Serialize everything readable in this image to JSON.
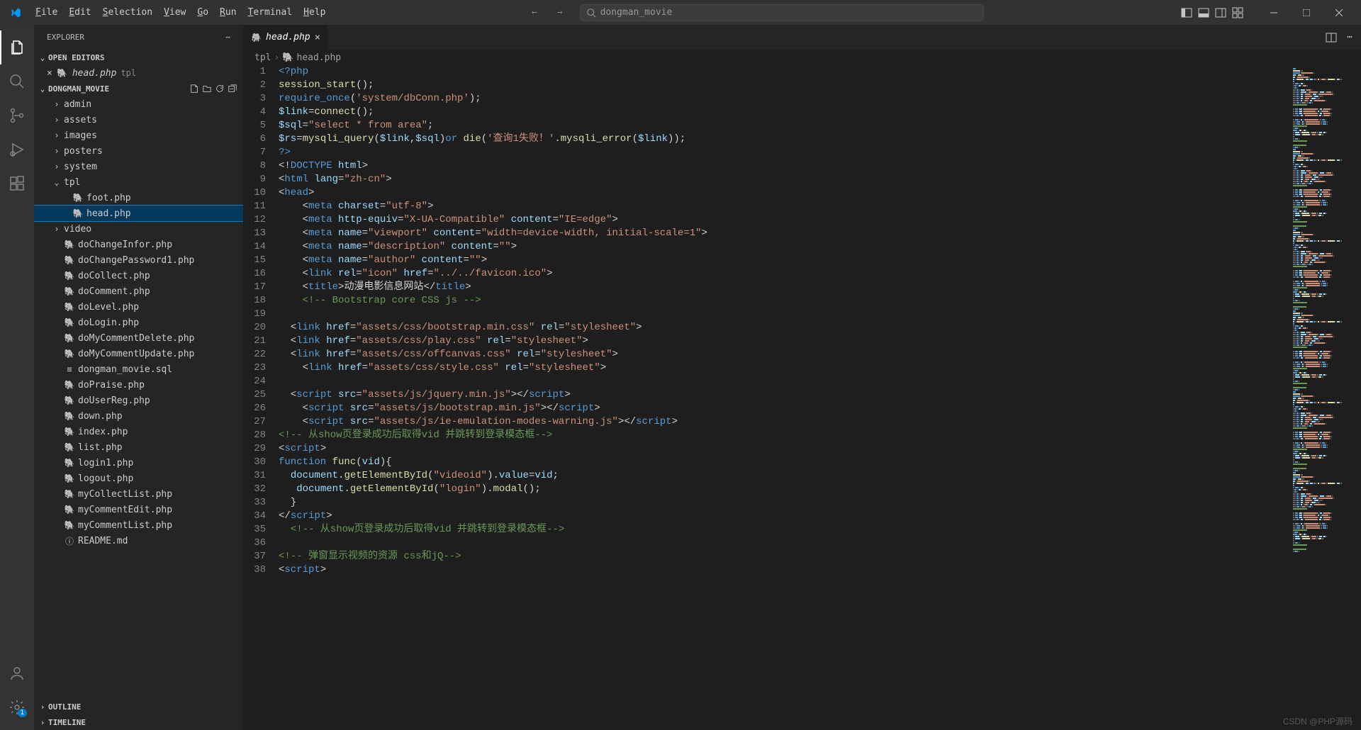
{
  "menu": [
    "File",
    "Edit",
    "Selection",
    "View",
    "Go",
    "Run",
    "Terminal",
    "Help"
  ],
  "search_text": "dongman_movie",
  "sidebar": {
    "title": "EXPLORER",
    "open_editors_label": "OPEN EDITORS",
    "open_file": "head.php",
    "open_file_folder": "tpl",
    "project": "DONGMAN_MOVIE",
    "outline": "OUTLINE",
    "timeline": "TIMELINE"
  },
  "tree": [
    {
      "type": "folder",
      "name": "admin",
      "depth": 0,
      "expanded": false
    },
    {
      "type": "folder",
      "name": "assets",
      "depth": 0,
      "expanded": false
    },
    {
      "type": "folder",
      "name": "images",
      "depth": 0,
      "expanded": false
    },
    {
      "type": "folder",
      "name": "posters",
      "depth": 0,
      "expanded": false
    },
    {
      "type": "folder",
      "name": "system",
      "depth": 0,
      "expanded": false
    },
    {
      "type": "folder",
      "name": "tpl",
      "depth": 0,
      "expanded": true
    },
    {
      "type": "file",
      "name": "foot.php",
      "depth": 1,
      "icon": "php"
    },
    {
      "type": "file",
      "name": "head.php",
      "depth": 1,
      "icon": "php",
      "active": true
    },
    {
      "type": "folder",
      "name": "video",
      "depth": 0,
      "expanded": false
    },
    {
      "type": "file",
      "name": "doChangeInfor.php",
      "depth": 0,
      "icon": "php"
    },
    {
      "type": "file",
      "name": "doChangePassword1.php",
      "depth": 0,
      "icon": "php"
    },
    {
      "type": "file",
      "name": "doCollect.php",
      "depth": 0,
      "icon": "php"
    },
    {
      "type": "file",
      "name": "doComment.php",
      "depth": 0,
      "icon": "php"
    },
    {
      "type": "file",
      "name": "doLevel.php",
      "depth": 0,
      "icon": "php"
    },
    {
      "type": "file",
      "name": "doLogin.php",
      "depth": 0,
      "icon": "php"
    },
    {
      "type": "file",
      "name": "doMyCommentDelete.php",
      "depth": 0,
      "icon": "php"
    },
    {
      "type": "file",
      "name": "doMyCommentUpdate.php",
      "depth": 0,
      "icon": "php"
    },
    {
      "type": "file",
      "name": "dongman_movie.sql",
      "depth": 0,
      "icon": "sql"
    },
    {
      "type": "file",
      "name": "doPraise.php",
      "depth": 0,
      "icon": "php"
    },
    {
      "type": "file",
      "name": "doUserReg.php",
      "depth": 0,
      "icon": "php"
    },
    {
      "type": "file",
      "name": "down.php",
      "depth": 0,
      "icon": "php"
    },
    {
      "type": "file",
      "name": "index.php",
      "depth": 0,
      "icon": "php"
    },
    {
      "type": "file",
      "name": "list.php",
      "depth": 0,
      "icon": "php"
    },
    {
      "type": "file",
      "name": "login1.php",
      "depth": 0,
      "icon": "php"
    },
    {
      "type": "file",
      "name": "logout.php",
      "depth": 0,
      "icon": "php"
    },
    {
      "type": "file",
      "name": "myCollectList.php",
      "depth": 0,
      "icon": "php"
    },
    {
      "type": "file",
      "name": "myCommentEdit.php",
      "depth": 0,
      "icon": "php"
    },
    {
      "type": "file",
      "name": "myCommentList.php",
      "depth": 0,
      "icon": "php"
    },
    {
      "type": "file",
      "name": "README.md",
      "depth": 0,
      "icon": "info"
    }
  ],
  "tab": {
    "name": "head.php"
  },
  "breadcrumbs": [
    "tpl",
    "head.php"
  ],
  "code": [
    {
      "n": 1,
      "tokens": [
        [
          "k",
          "<?php"
        ]
      ]
    },
    {
      "n": 2,
      "tokens": [
        [
          "f",
          "session_start"
        ],
        [
          "p",
          "();"
        ]
      ]
    },
    {
      "n": 3,
      "tokens": [
        [
          "k",
          "require_once"
        ],
        [
          "p",
          "("
        ],
        [
          "s",
          "'system/dbConn.php'"
        ],
        [
          "p",
          ");"
        ]
      ]
    },
    {
      "n": 4,
      "tokens": [
        [
          "v",
          "$link"
        ],
        [
          "p",
          "="
        ],
        [
          "f",
          "connect"
        ],
        [
          "p",
          "();"
        ]
      ]
    },
    {
      "n": 5,
      "tokens": [
        [
          "v",
          "$sql"
        ],
        [
          "p",
          "="
        ],
        [
          "s",
          "\"select * from area\""
        ],
        [
          "p",
          ";"
        ]
      ]
    },
    {
      "n": 6,
      "tokens": [
        [
          "v",
          "$rs"
        ],
        [
          "p",
          "="
        ],
        [
          "f",
          "mysqli_query"
        ],
        [
          "p",
          "("
        ],
        [
          "v",
          "$link"
        ],
        [
          "p",
          ","
        ],
        [
          "v",
          "$sql"
        ],
        [
          "p",
          ")"
        ],
        [
          "k",
          "or"
        ],
        [
          "p",
          " "
        ],
        [
          "f",
          "die"
        ],
        [
          "p",
          "("
        ],
        [
          "s",
          "'查询1失败！'"
        ],
        [
          "p",
          "."
        ],
        [
          "f",
          "mysqli_error"
        ],
        [
          "p",
          "("
        ],
        [
          "v",
          "$link"
        ],
        [
          "p",
          "));"
        ]
      ]
    },
    {
      "n": 7,
      "tokens": [
        [
          "k",
          "?>"
        ]
      ]
    },
    {
      "n": 8,
      "tokens": [
        [
          "p",
          "<!"
        ],
        [
          "doctype",
          "DOCTYPE"
        ],
        [
          "p",
          " "
        ],
        [
          "v",
          "html"
        ],
        [
          "p",
          ">"
        ]
      ]
    },
    {
      "n": 9,
      "tokens": [
        [
          "p",
          "<"
        ],
        [
          "t",
          "html"
        ],
        [
          "p",
          " "
        ],
        [
          "v",
          "lang"
        ],
        [
          "p",
          "="
        ],
        [
          "s",
          "\"zh-cn\""
        ],
        [
          "p",
          ">"
        ]
      ]
    },
    {
      "n": 10,
      "tokens": [
        [
          "p",
          "<"
        ],
        [
          "t",
          "head"
        ],
        [
          "p",
          ">"
        ]
      ]
    },
    {
      "n": 11,
      "tokens": [
        [
          "p",
          "    <"
        ],
        [
          "t",
          "meta"
        ],
        [
          "p",
          " "
        ],
        [
          "v",
          "charset"
        ],
        [
          "p",
          "="
        ],
        [
          "s",
          "\"utf-8\""
        ],
        [
          "p",
          ">"
        ]
      ]
    },
    {
      "n": 12,
      "tokens": [
        [
          "p",
          "    <"
        ],
        [
          "t",
          "meta"
        ],
        [
          "p",
          " "
        ],
        [
          "v",
          "http-equiv"
        ],
        [
          "p",
          "="
        ],
        [
          "s",
          "\"X-UA-Compatible\""
        ],
        [
          "p",
          " "
        ],
        [
          "v",
          "content"
        ],
        [
          "p",
          "="
        ],
        [
          "s",
          "\"IE=edge\""
        ],
        [
          "p",
          ">"
        ]
      ]
    },
    {
      "n": 13,
      "tokens": [
        [
          "p",
          "    <"
        ],
        [
          "t",
          "meta"
        ],
        [
          "p",
          " "
        ],
        [
          "v",
          "name"
        ],
        [
          "p",
          "="
        ],
        [
          "s",
          "\"viewport\""
        ],
        [
          "p",
          " "
        ],
        [
          "v",
          "content"
        ],
        [
          "p",
          "="
        ],
        [
          "s",
          "\"width=device-width, initial-scale=1\""
        ],
        [
          "p",
          ">"
        ]
      ]
    },
    {
      "n": 14,
      "tokens": [
        [
          "p",
          "    <"
        ],
        [
          "t",
          "meta"
        ],
        [
          "p",
          " "
        ],
        [
          "v",
          "name"
        ],
        [
          "p",
          "="
        ],
        [
          "s",
          "\"description\""
        ],
        [
          "p",
          " "
        ],
        [
          "v",
          "content"
        ],
        [
          "p",
          "="
        ],
        [
          "s",
          "\"\""
        ],
        [
          "p",
          ">"
        ]
      ]
    },
    {
      "n": 15,
      "tokens": [
        [
          "p",
          "    <"
        ],
        [
          "t",
          "meta"
        ],
        [
          "p",
          " "
        ],
        [
          "v",
          "name"
        ],
        [
          "p",
          "="
        ],
        [
          "s",
          "\"author\""
        ],
        [
          "p",
          " "
        ],
        [
          "v",
          "content"
        ],
        [
          "p",
          "="
        ],
        [
          "s",
          "\"\""
        ],
        [
          "p",
          ">"
        ]
      ]
    },
    {
      "n": 16,
      "tokens": [
        [
          "p",
          "    <"
        ],
        [
          "t",
          "link"
        ],
        [
          "p",
          " "
        ],
        [
          "v",
          "rel"
        ],
        [
          "p",
          "="
        ],
        [
          "s",
          "\"icon\""
        ],
        [
          "p",
          " "
        ],
        [
          "v",
          "href"
        ],
        [
          "p",
          "="
        ],
        [
          "s",
          "\"../../favicon.ico\""
        ],
        [
          "p",
          ">"
        ]
      ]
    },
    {
      "n": 17,
      "tokens": [
        [
          "p",
          "    <"
        ],
        [
          "t",
          "title"
        ],
        [
          "p",
          ">"
        ],
        [
          "txt",
          "动漫电影信息网站"
        ],
        [
          "p",
          "</"
        ],
        [
          "t",
          "title"
        ],
        [
          "p",
          ">"
        ]
      ]
    },
    {
      "n": 18,
      "tokens": [
        [
          "c",
          "    <!-- Bootstrap core CSS js -->"
        ]
      ]
    },
    {
      "n": 19,
      "tokens": []
    },
    {
      "n": 20,
      "tokens": [
        [
          "p",
          "  <"
        ],
        [
          "t",
          "link"
        ],
        [
          "p",
          " "
        ],
        [
          "v",
          "href"
        ],
        [
          "p",
          "="
        ],
        [
          "s",
          "\"assets/css/bootstrap.min.css\""
        ],
        [
          "p",
          " "
        ],
        [
          "v",
          "rel"
        ],
        [
          "p",
          "="
        ],
        [
          "s",
          "\"stylesheet\""
        ],
        [
          "p",
          ">"
        ]
      ]
    },
    {
      "n": 21,
      "tokens": [
        [
          "p",
          "  <"
        ],
        [
          "t",
          "link"
        ],
        [
          "p",
          " "
        ],
        [
          "v",
          "href"
        ],
        [
          "p",
          "="
        ],
        [
          "s",
          "\"assets/css/play.css\""
        ],
        [
          "p",
          " "
        ],
        [
          "v",
          "rel"
        ],
        [
          "p",
          "="
        ],
        [
          "s",
          "\"stylesheet\""
        ],
        [
          "p",
          ">"
        ]
      ]
    },
    {
      "n": 22,
      "tokens": [
        [
          "p",
          "  <"
        ],
        [
          "t",
          "link"
        ],
        [
          "p",
          " "
        ],
        [
          "v",
          "href"
        ],
        [
          "p",
          "="
        ],
        [
          "s",
          "\"assets/css/offcanvas.css\""
        ],
        [
          "p",
          " "
        ],
        [
          "v",
          "rel"
        ],
        [
          "p",
          "="
        ],
        [
          "s",
          "\"stylesheet\""
        ],
        [
          "p",
          ">"
        ]
      ]
    },
    {
      "n": 23,
      "tokens": [
        [
          "p",
          "    <"
        ],
        [
          "t",
          "link"
        ],
        [
          "p",
          " "
        ],
        [
          "v",
          "href"
        ],
        [
          "p",
          "="
        ],
        [
          "s",
          "\"assets/css/style.css\""
        ],
        [
          "p",
          " "
        ],
        [
          "v",
          "rel"
        ],
        [
          "p",
          "="
        ],
        [
          "s",
          "\"stylesheet\""
        ],
        [
          "p",
          ">"
        ]
      ]
    },
    {
      "n": 24,
      "tokens": []
    },
    {
      "n": 25,
      "tokens": [
        [
          "p",
          "  <"
        ],
        [
          "t",
          "script"
        ],
        [
          "p",
          " "
        ],
        [
          "v",
          "src"
        ],
        [
          "p",
          "="
        ],
        [
          "s",
          "\"assets/js/jquery.min.js\""
        ],
        [
          "p",
          "></"
        ],
        [
          "t",
          "script"
        ],
        [
          "p",
          ">"
        ]
      ]
    },
    {
      "n": 26,
      "tokens": [
        [
          "p",
          "    <"
        ],
        [
          "t",
          "script"
        ],
        [
          "p",
          " "
        ],
        [
          "v",
          "src"
        ],
        [
          "p",
          "="
        ],
        [
          "s",
          "\"assets/js/bootstrap.min.js\""
        ],
        [
          "p",
          "></"
        ],
        [
          "t",
          "script"
        ],
        [
          "p",
          ">"
        ]
      ]
    },
    {
      "n": 27,
      "tokens": [
        [
          "p",
          "    <"
        ],
        [
          "t",
          "script"
        ],
        [
          "p",
          " "
        ],
        [
          "v",
          "src"
        ],
        [
          "p",
          "="
        ],
        [
          "s",
          "\"assets/js/ie-emulation-modes-warning.js\""
        ],
        [
          "p",
          "></"
        ],
        [
          "t",
          "script"
        ],
        [
          "p",
          ">"
        ]
      ]
    },
    {
      "n": 28,
      "tokens": [
        [
          "c",
          "<!-- 从show页登录成功后取得vid 并跳转到登录模态框-->"
        ]
      ]
    },
    {
      "n": 29,
      "tokens": [
        [
          "p",
          "<"
        ],
        [
          "t",
          "script"
        ],
        [
          "p",
          ">"
        ]
      ]
    },
    {
      "n": 30,
      "tokens": [
        [
          "k",
          "function"
        ],
        [
          "p",
          " "
        ],
        [
          "f",
          "func"
        ],
        [
          "p",
          "("
        ],
        [
          "v",
          "vid"
        ],
        [
          "p",
          "){"
        ]
      ]
    },
    {
      "n": 31,
      "tokens": [
        [
          "p",
          "  "
        ],
        [
          "v",
          "document"
        ],
        [
          "p",
          "."
        ],
        [
          "f",
          "getElementById"
        ],
        [
          "p",
          "("
        ],
        [
          "s",
          "\"videoid\""
        ],
        [
          "p",
          ")."
        ],
        [
          "v",
          "value"
        ],
        [
          "p",
          "="
        ],
        [
          "v",
          "vid"
        ],
        [
          "p",
          ";"
        ]
      ]
    },
    {
      "n": 32,
      "tokens": [
        [
          "p",
          "   "
        ],
        [
          "v",
          "document"
        ],
        [
          "p",
          "."
        ],
        [
          "f",
          "getElementById"
        ],
        [
          "p",
          "("
        ],
        [
          "s",
          "\"login\""
        ],
        [
          "p",
          ")."
        ],
        [
          "f",
          "modal"
        ],
        [
          "p",
          "();"
        ]
      ]
    },
    {
      "n": 33,
      "tokens": [
        [
          "p",
          "  }"
        ]
      ]
    },
    {
      "n": 34,
      "tokens": [
        [
          "p",
          "</"
        ],
        [
          "t",
          "script"
        ],
        [
          "p",
          ">"
        ]
      ]
    },
    {
      "n": 35,
      "tokens": [
        [
          "c",
          "  <!-- 从show页登录成功后取得vid 并跳转到登录模态框-->"
        ]
      ]
    },
    {
      "n": 36,
      "tokens": []
    },
    {
      "n": 37,
      "tokens": [
        [
          "c",
          "<!-- 弹窗显示视频的资源 css和jQ-->"
        ]
      ]
    },
    {
      "n": 38,
      "tokens": [
        [
          "p",
          "<"
        ],
        [
          "t",
          "script"
        ],
        [
          "p",
          ">"
        ]
      ]
    }
  ],
  "watermark": "CSDN @PHP源码"
}
